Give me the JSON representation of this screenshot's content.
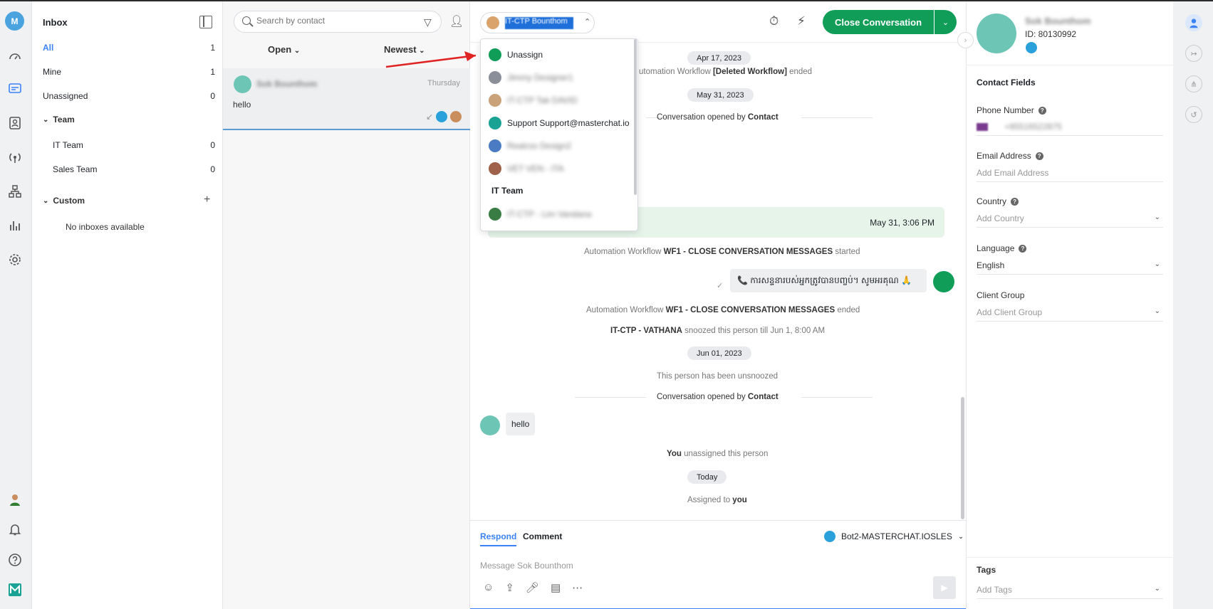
{
  "rail": {
    "avatar_letter": "M"
  },
  "nav": {
    "title": "Inbox",
    "items": [
      {
        "label": "All",
        "count": "1"
      },
      {
        "label": "Mine",
        "count": "1"
      },
      {
        "label": "Unassigned",
        "count": "0"
      }
    ],
    "team_section": "Team",
    "teams": [
      {
        "label": "IT Team",
        "count": "0"
      },
      {
        "label": "Sales Team",
        "count": "0"
      }
    ],
    "custom_section": "Custom",
    "custom_empty": "No inboxes available"
  },
  "list": {
    "search_placeholder": "Search by contact",
    "status_filter": "Open",
    "sort": "Newest",
    "conversation": {
      "name": "Sok Bounthom",
      "time": "Thursday",
      "message": "hello"
    }
  },
  "chat": {
    "assignee": "IT-CTP Bounthom",
    "close_button": "Close Conversation",
    "dates": {
      "d1": "Apr 17, 2023",
      "d2": "May 31, 2023",
      "d3": "Jun 01, 2023",
      "d4": "Today"
    },
    "events": {
      "workflow_deleted_ended": "utomation Workflow ",
      "workflow_deleted_name": "[Deleted Workflow]",
      "ended": " ended",
      "opened_prefix": "Conversation opened by ",
      "opened_by": "Contact",
      "wf1_prefix": "Automation Workflow ",
      "wf1_name": "WF1 - CLOSE CONVERSATION MESSAGES",
      "started": " started",
      "snooze_actor": "IT-CTP - VATHANA",
      "snooze_text": " snoozed this person till Jun 1, 8:00 AM",
      "unsnoozed": "This person has been unsnoozed",
      "you": "You",
      "unassigned_text": " unassigned this person",
      "assigned_prefix": "Assigned to ",
      "assigned_you": "you"
    },
    "green_msg_time": "May 31, 3:06 PM",
    "khmer_msg": "📞 ការសន្ទនារបស់អ្នកត្រូវបានបញ្ចប់។ សូមអរគុណ 🙏",
    "incoming_msg": "hello",
    "compose": {
      "tab_respond": "Respond",
      "tab_comment": "Comment",
      "inbox": "Bot2-MASTERCHAT.IOSLES",
      "placeholder": "Message Sok Bounthom"
    }
  },
  "menu": {
    "unassign": "Unassign",
    "agents": [
      {
        "name": "Jimmy Designer1",
        "color": "#8a8f99"
      },
      {
        "name": "IT-CTP Tak DAVID",
        "color": "#c9a27a"
      },
      {
        "name": "Support Support@masterchat.io",
        "color": "#1aa394"
      },
      {
        "name": "Realcss Design2",
        "color": "#4b7bc2"
      },
      {
        "name": "VET VEN - ITA",
        "color": "#a0614a"
      }
    ],
    "group": "IT Team",
    "group_agent": "IT-CTP - Lim Vandana"
  },
  "contact": {
    "name": "Sok Bounthom",
    "id": "ID: 80130992",
    "fields_heading": "Contact Fields",
    "phone_label": "Phone Number",
    "phone_value": "+85516522875",
    "email_label": "Email Address",
    "email_placeholder": "Add Email Address",
    "country_label": "Country",
    "country_placeholder": "Add Country",
    "language_label": "Language",
    "language_value": "English",
    "client_group_label": "Client Group",
    "client_group_placeholder": "Add Client Group",
    "tags_label": "Tags",
    "tags_placeholder": "Add Tags"
  },
  "colors": {
    "accent": "#3b82f6",
    "brand_green": "#0f9d58",
    "telegram": "#2aa1da"
  }
}
